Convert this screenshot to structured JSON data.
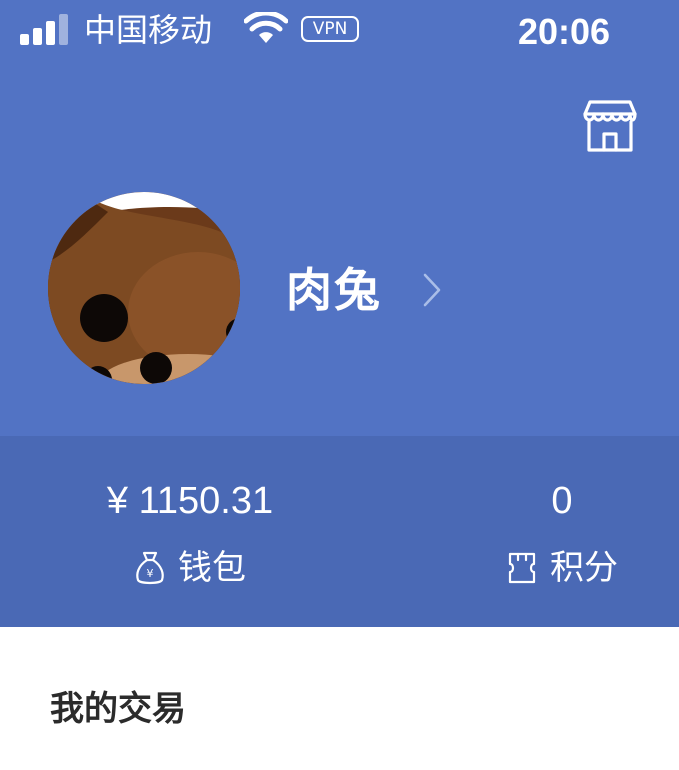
{
  "status_bar": {
    "carrier": "中国移动",
    "vpn": "VPN",
    "time": "20:06"
  },
  "profile": {
    "username": "肉兔"
  },
  "stats": {
    "wallet": {
      "value": "¥ 1150.31",
      "label": "钱包"
    },
    "points": {
      "value": "0",
      "label": "积分"
    }
  },
  "sections": {
    "my_trades_title": "我的交易"
  },
  "colors": {
    "header_bg": "#5273C4",
    "stats_bg": "#4A69B5",
    "text_on_header": "#FFFFFF",
    "section_title": "#2B2B2B"
  },
  "icons": {
    "shop": "storefront-icon",
    "wallet": "money-bag-icon",
    "points": "ticket-icon",
    "chevron": "chevron-right-icon"
  }
}
